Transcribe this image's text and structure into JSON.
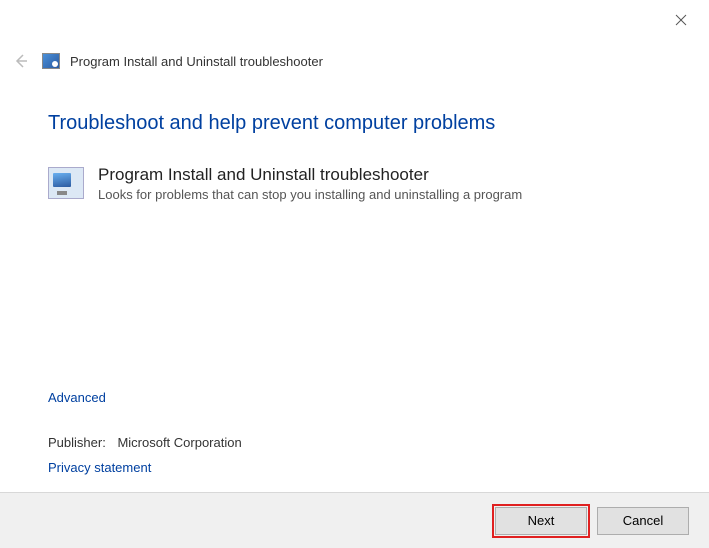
{
  "window": {
    "title": "Program Install and Uninstall troubleshooter"
  },
  "page": {
    "heading": "Troubleshoot and help prevent computer problems"
  },
  "item": {
    "title": "Program Install and Uninstall troubleshooter",
    "description": "Looks for problems that can stop you installing and uninstalling a program"
  },
  "links": {
    "advanced": "Advanced",
    "privacy": "Privacy statement"
  },
  "publisher": {
    "label": "Publisher:",
    "name": "Microsoft Corporation"
  },
  "buttons": {
    "next": "Next",
    "cancel": "Cancel"
  }
}
